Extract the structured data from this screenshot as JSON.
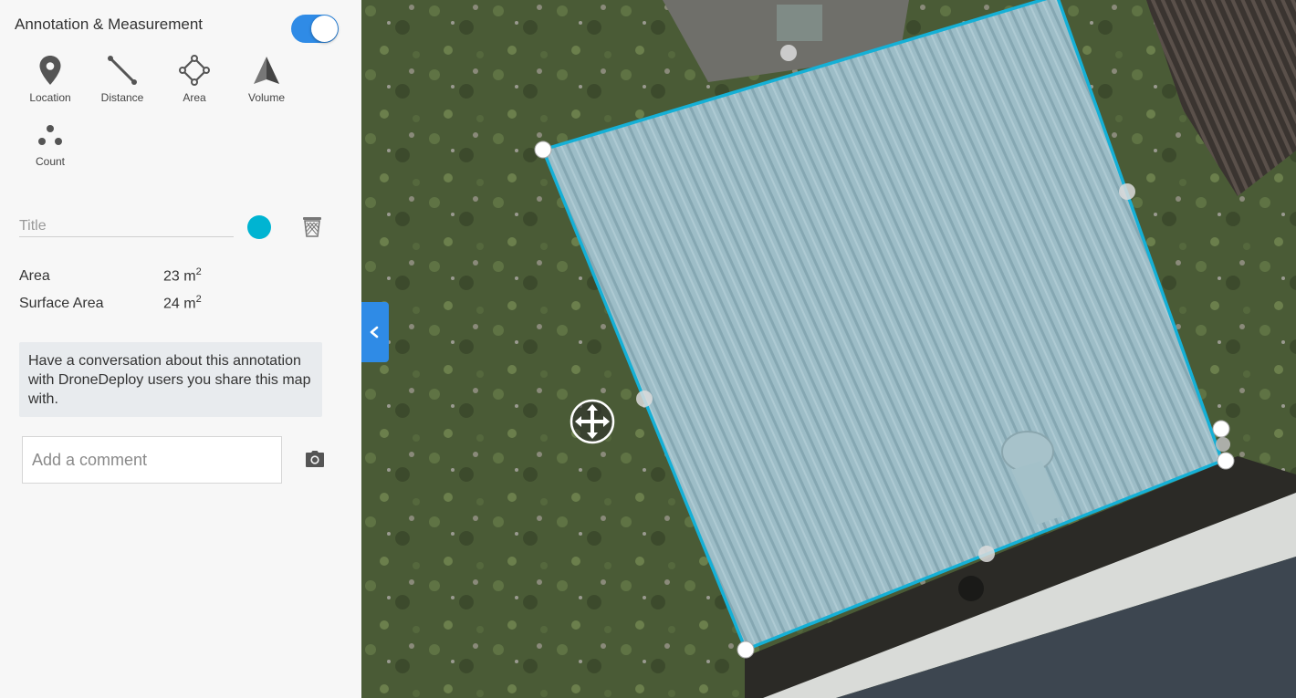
{
  "panel": {
    "title": "Annotation & Measurement",
    "toggle_on": true,
    "accent_color": "#2f8be6"
  },
  "tools": [
    {
      "label": "Location",
      "icon": "location-pin-icon"
    },
    {
      "label": "Distance",
      "icon": "distance-line-icon"
    },
    {
      "label": "Area",
      "icon": "area-polygon-icon"
    },
    {
      "label": "Volume",
      "icon": "volume-pyramid-icon"
    },
    {
      "label": "Count",
      "icon": "count-dots-icon"
    }
  ],
  "annotation": {
    "title_placeholder": "Title",
    "color": "#00b4d2",
    "measurements": [
      {
        "label": "Area",
        "value": "23 m",
        "exponent": "2"
      },
      {
        "label": "Surface Area",
        "value": "24 m",
        "exponent": "2"
      }
    ],
    "info_text": "Have a conversation about this annotation with DroneDeploy users you share this map with.",
    "comment_placeholder": "Add a comment"
  },
  "map": {
    "polygon_color": "#15b0d6"
  }
}
